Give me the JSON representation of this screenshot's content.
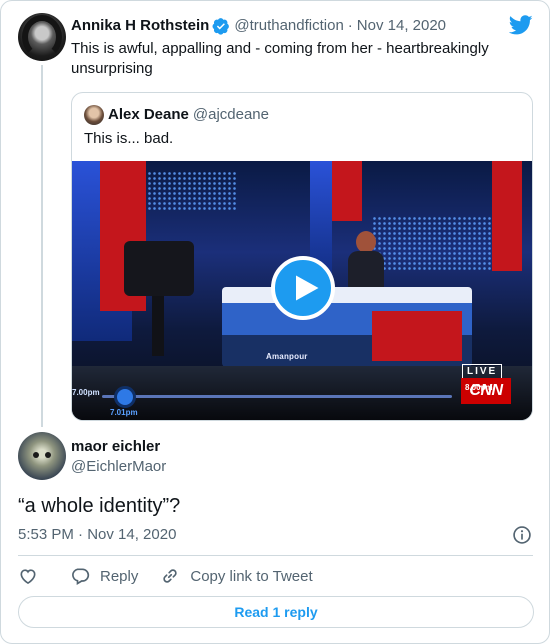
{
  "tweet": {
    "author_name": "Annika H Rothstein",
    "author_handle": "@truthandfiction",
    "separator": "·",
    "date": "Nov 14, 2020",
    "text": "This is awful, appalling and - coming from her - heartbreakingly unsurprising",
    "verified": true
  },
  "quoted": {
    "author_name": "Alex Deane",
    "author_handle": "@ajcdeane",
    "text": "This is... bad.",
    "video": {
      "overlay_name": "Amanpour",
      "live_label": "LIVE",
      "network": "CNN",
      "time_left": "7.00pm",
      "time_under": "7.01pm",
      "time_right": "8.00pm"
    }
  },
  "reply": {
    "author_name": "maor eichler",
    "author_handle": "@EichlerMaor",
    "text": "“a whole identity”?",
    "timestamp": "5:53 PM · Nov 14, 2020"
  },
  "actions": {
    "reply_label": "Reply",
    "copy_label": "Copy link to Tweet",
    "read_replies_label": "Read 1 reply"
  },
  "colors": {
    "accent": "#1d9bf0",
    "muted": "#536471",
    "border": "#cfd9de",
    "cnn_red": "#cc0000"
  },
  "icons": [
    "twitter-logo-icon",
    "verified-badge-icon",
    "play-icon",
    "info-icon",
    "heart-icon",
    "reply-icon",
    "link-icon"
  ]
}
